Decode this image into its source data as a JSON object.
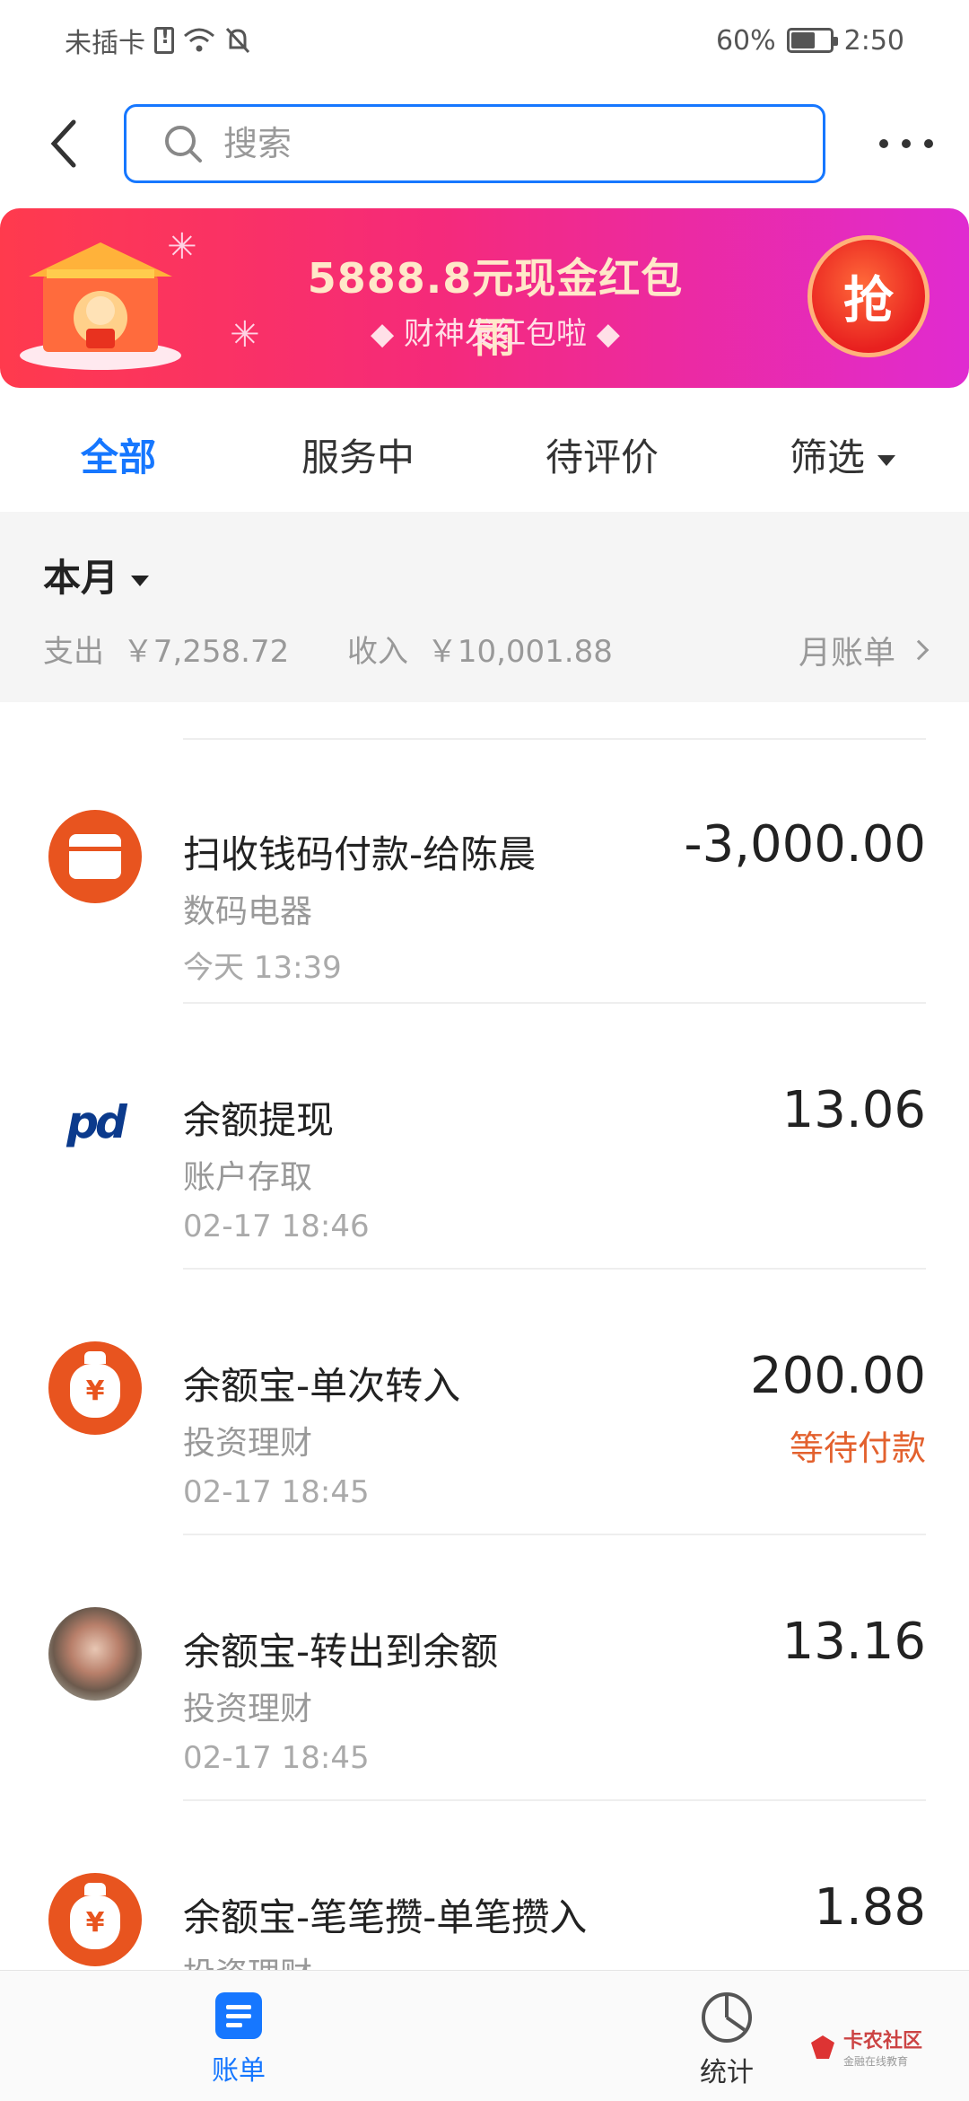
{
  "status_bar": {
    "carrier": "未插卡",
    "battery": "60%",
    "battery_level": 0.6,
    "time": "2:50"
  },
  "header": {
    "search_placeholder": "搜索"
  },
  "banner": {
    "title": "5888.8元现金红包雨",
    "subtitle": "财神发红包啦",
    "button": "抢"
  },
  "tabs": [
    "全部",
    "服务中",
    "待评价",
    "筛选"
  ],
  "summary": {
    "month": "本月",
    "expense_label": "支出",
    "expense": "￥7,258.72",
    "income_label": "收入",
    "income": "￥10,001.88",
    "monthly_bill": "月账单"
  },
  "transactions": [
    {
      "title": "扫收钱码付款-给陈晨",
      "category": "数码电器",
      "time": "今天  13:39",
      "amount": "-3,000.00",
      "status": "",
      "icon": "store-icon"
    },
    {
      "title": "余额提现",
      "category": "账户存取",
      "time": "02-17  18:46",
      "amount": "13.06",
      "status": "",
      "icon": "bank-logo-icon"
    },
    {
      "title": "余额宝-单次转入",
      "category": "投资理财",
      "time": "02-17  18:45",
      "amount": "200.00",
      "status": "等待付款",
      "icon": "money-bag-icon"
    },
    {
      "title": "余额宝-转出到余额",
      "category": "投资理财",
      "time": "02-17  18:45",
      "amount": "13.16",
      "status": "",
      "icon": "user-avatar"
    },
    {
      "title": "余额宝-笔笔攒-单笔攒入",
      "category": "投资理财",
      "time": "",
      "amount": "1.88",
      "status": "",
      "icon": "money-bag-icon"
    }
  ],
  "bottom_nav": {
    "bill": "账单",
    "stats": "统计"
  },
  "watermark": {
    "name": "卡农社区",
    "tagline": "金融在线教育"
  },
  "colors": {
    "accent": "#1677ff",
    "warning": "#e3612e",
    "banner_start": "#ff3a4d",
    "banner_end": "#e02bd1"
  }
}
